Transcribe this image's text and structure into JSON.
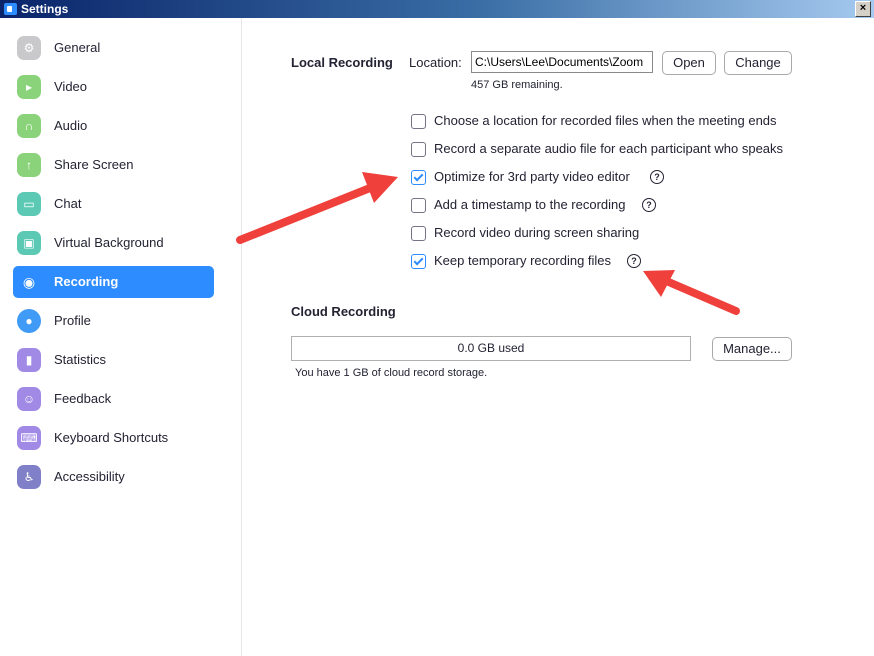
{
  "window": {
    "title": "Settings",
    "close_label": "×"
  },
  "sidebar": {
    "items": [
      {
        "label": "General",
        "color": "#c9c9cc",
        "glyph": "⚙"
      },
      {
        "label": "Video",
        "color": "#8bd37b",
        "glyph": "▸"
      },
      {
        "label": "Audio",
        "color": "#8bd37b",
        "glyph": "∩"
      },
      {
        "label": "Share Screen",
        "color": "#8bd37b",
        "glyph": "↑"
      },
      {
        "label": "Chat",
        "color": "#5bc9b4",
        "glyph": "▭"
      },
      {
        "label": "Virtual Background",
        "color": "#5bc9b4",
        "glyph": "▣"
      },
      {
        "label": "Recording",
        "color": "#ffffff",
        "glyph": "◉"
      },
      {
        "label": "Profile",
        "color": "#3f9bf5",
        "glyph": "●"
      },
      {
        "label": "Statistics",
        "color": "#a08ae6",
        "glyph": "▮"
      },
      {
        "label": "Feedback",
        "color": "#a08ae6",
        "glyph": "☺"
      },
      {
        "label": "Keyboard Shortcuts",
        "color": "#a08ae6",
        "glyph": "⌨"
      },
      {
        "label": "Accessibility",
        "color": "#8080c8",
        "glyph": "♿"
      }
    ],
    "active_index": 6
  },
  "local_recording": {
    "title": "Local Recording",
    "location_label": "Location:",
    "location_value": "C:\\Users\\Lee\\Documents\\Zoom",
    "open_label": "Open",
    "change_label": "Change",
    "remaining": "457 GB remaining.",
    "options": [
      {
        "label": "Choose a location for recorded files when the meeting ends",
        "checked": false,
        "help": false
      },
      {
        "label": "Record a separate audio file for each participant who speaks",
        "checked": false,
        "help": false
      },
      {
        "label": "Optimize for 3rd party video editor",
        "checked": true,
        "help": true
      },
      {
        "label": "Add a timestamp to the recording",
        "checked": false,
        "help": true
      },
      {
        "label": "Record video during screen sharing",
        "checked": false,
        "help": false
      },
      {
        "label": "Keep temporary recording files",
        "checked": true,
        "help": true
      }
    ]
  },
  "cloud_recording": {
    "title": "Cloud Recording",
    "used": "0.0 GB used",
    "manage_label": "Manage...",
    "note": "You have 1 GB of cloud record storage."
  },
  "colors": {
    "accent": "#2d8cff",
    "arrow": "#f0403c"
  }
}
